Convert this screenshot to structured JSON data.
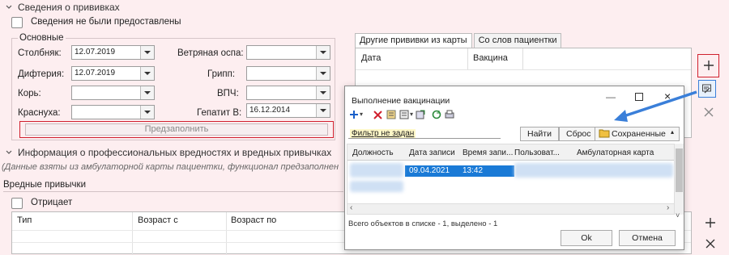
{
  "vaccinations": {
    "section_title": "Сведения о прививках",
    "not_provided_label": "Сведения не были предоставлены",
    "basic_group_label": "Основные",
    "fields": [
      {
        "label": "Столбняк:",
        "value": "12.07.2019"
      },
      {
        "label": "Дифтерия:",
        "value": "12.07.2019"
      },
      {
        "label": "Корь:",
        "value": ""
      },
      {
        "label": "Краснуха:",
        "value": ""
      },
      {
        "label": "Ветряная оспа:",
        "value": ""
      },
      {
        "label": "Грипп:",
        "value": ""
      },
      {
        "label": "ВПЧ:",
        "value": ""
      },
      {
        "label": "Гепатит В:",
        "value": "16.12.2014"
      }
    ],
    "prefill_button": "Предзаполнить",
    "tabs": [
      "Другие прививки из карты",
      "Со слов пациентки"
    ],
    "columns": [
      "Дата",
      "Вакцина"
    ]
  },
  "professional": {
    "section_title": "Информация о профессиональных вредностях и вредных привычках",
    "note": "(Данные взяты из амбулаторной карты пациентки, функционал предзаполнен",
    "habits_label": "Вредные привычки",
    "denies_label": "Отрицает",
    "columns": [
      "Тип",
      "Возраст с",
      "Возраст по"
    ]
  },
  "dialog": {
    "title": "Выполнение вакцинации",
    "filter_text": "Фильтр не задан",
    "find_button": "Найти",
    "reset_button": "Сброс",
    "saved_button": "Сохраненные",
    "columns": [
      "Должность",
      "Дата записи",
      "Время запи...",
      "Пользоват...",
      "Амбулаторная карта"
    ],
    "row": {
      "date": "09.04.2021",
      "time": "13:42"
    },
    "status": "Всего объектов в списке - 1, выделено - 1",
    "ok_button": "Ok",
    "cancel_button": "Отмена"
  },
  "colors": {
    "accent_red": "#d0202e",
    "arrow_blue": "#3a7fd9",
    "selection": "#1a7ad6"
  }
}
